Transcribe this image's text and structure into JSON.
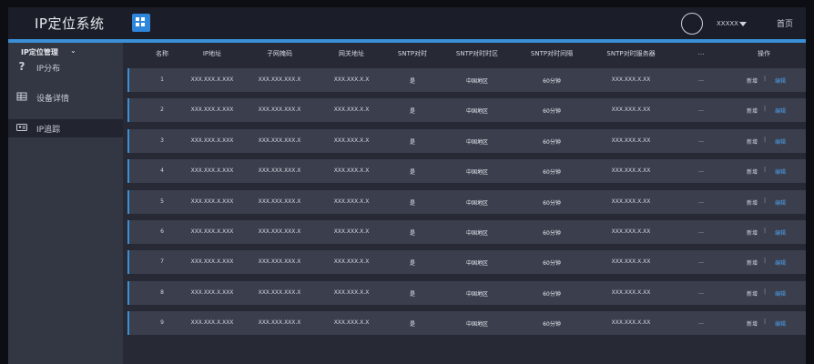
{
  "app": {
    "title": "IP定位系统",
    "username": "XXXXX",
    "home_label": "首页"
  },
  "icons": {
    "grid": "grid-icon",
    "avatar": "avatar-icon",
    "caret": "caret-down-icon"
  },
  "colors": {
    "accent": "#3a8fd6",
    "edit_link": "#4d9de6",
    "row_bg": "#3a3e4d",
    "sidebar_bg": "#333744"
  },
  "sidebar": {
    "section": "IP定位管理",
    "items": [
      {
        "label": "IP分布",
        "icon": "question-icon",
        "active": false
      },
      {
        "label": "设备详情",
        "icon": "table-icon",
        "active": false
      },
      {
        "label": "IP追踪",
        "icon": "id-card-icon",
        "active": true
      }
    ]
  },
  "table": {
    "headers": [
      "名称",
      "IP地址",
      "子网掩码",
      "网关地址",
      "SNTP对时",
      "SNTP对时时区",
      "SNTP对时间隔",
      "SNTP对时服务器",
      "…",
      "操作"
    ],
    "action_add": "新增",
    "action_sep": "|",
    "action_edit": "编辑",
    "rows": [
      [
        "1",
        "XXX.XXX.X.XXX",
        "XXX.XXX.XXX.X",
        "XXX.XXX.X.X",
        "是",
        "中国地区",
        "60分钟",
        "XXX.XXX.X.XX",
        "…"
      ],
      [
        "2",
        "XXX.XXX.X.XXX",
        "XXX.XXX.XXX.X",
        "XXX.XXX.X.X",
        "是",
        "中国地区",
        "60分钟",
        "XXX.XXX.X.XX",
        "…"
      ],
      [
        "3",
        "XXX.XXX.X.XXX",
        "XXX.XXX.XXX.X",
        "XXX.XXX.X.X",
        "是",
        "中国地区",
        "60分钟",
        "XXX.XXX.X.XX",
        "…"
      ],
      [
        "4",
        "XXX.XXX.X.XXX",
        "XXX.XXX.XXX.X",
        "XXX.XXX.X.X",
        "是",
        "中国地区",
        "60分钟",
        "XXX.XXX.X.XX",
        "…"
      ],
      [
        "5",
        "XXX.XXX.X.XXX",
        "XXX.XXX.XXX.X",
        "XXX.XXX.X.X",
        "是",
        "中国地区",
        "60分钟",
        "XXX.XXX.X.XX",
        "…"
      ],
      [
        "6",
        "XXX.XXX.X.XXX",
        "XXX.XXX.XXX.X",
        "XXX.XXX.X.X",
        "是",
        "中国地区",
        "60分钟",
        "XXX.XXX.X.XX",
        "…"
      ],
      [
        "7",
        "XXX.XXX.X.XXX",
        "XXX.XXX.XXX.X",
        "XXX.XXX.X.X",
        "是",
        "中国地区",
        "60分钟",
        "XXX.XXX.X.XX",
        "…"
      ],
      [
        "8",
        "XXX.XXX.X.XXX",
        "XXX.XXX.XXX.X",
        "XXX.XXX.X.X",
        "是",
        "中国地区",
        "60分钟",
        "XXX.XXX.X.XX",
        "…"
      ],
      [
        "9",
        "XXX.XXX.X.XXX",
        "XXX.XXX.XXX.X",
        "XXX.XXX.X.X",
        "是",
        "中国地区",
        "60分钟",
        "XXX.XXX.X.XX",
        "…"
      ]
    ]
  }
}
